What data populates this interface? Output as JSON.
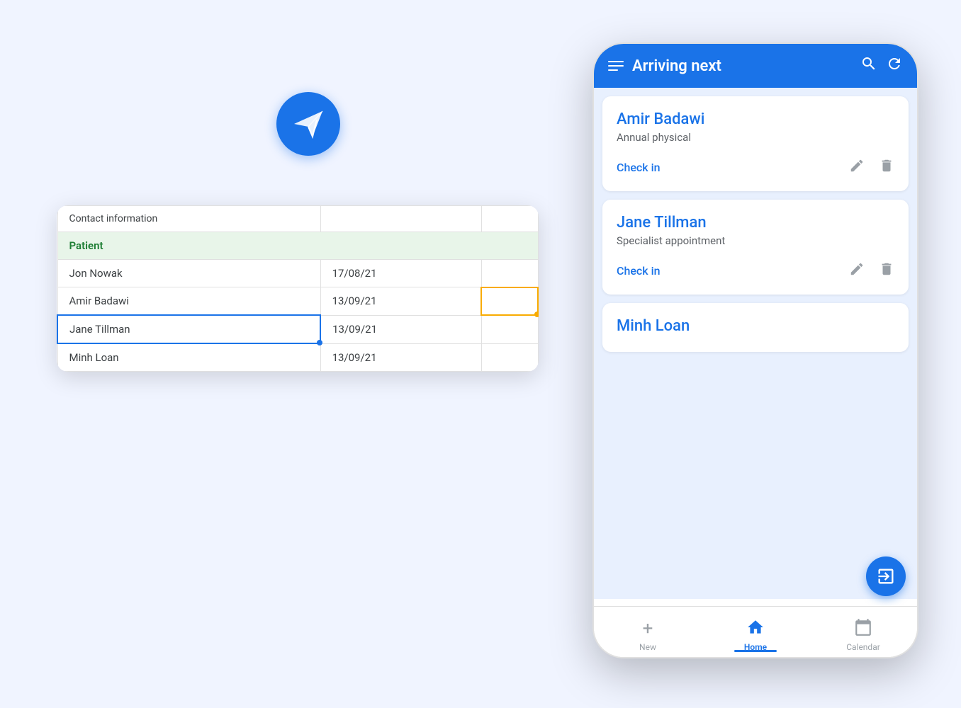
{
  "app": {
    "background": "#f0f4ff"
  },
  "spreadsheet": {
    "header": "Contact information",
    "section": "Patient",
    "rows": [
      {
        "name": "Jon Nowak",
        "date": "17/08/21",
        "extra": ""
      },
      {
        "name": "Amir Badawi",
        "date": "13/09/21",
        "extra": ""
      },
      {
        "name": "Jane Tillman",
        "date": "13/09/21",
        "extra": ""
      },
      {
        "name": "Minh Loan",
        "date": "13/09/21",
        "extra": ""
      }
    ]
  },
  "phone": {
    "header": {
      "title": "Arriving next",
      "search_label": "search",
      "refresh_label": "refresh"
    },
    "patients": [
      {
        "name": "Amir Badawi",
        "type": "Annual physical",
        "action": "Check in"
      },
      {
        "name": "Jane Tillman",
        "type": "Specialist appointment",
        "action": "Check in"
      },
      {
        "name": "Minh Loan",
        "type": "",
        "action": ""
      }
    ],
    "nav": {
      "items": [
        {
          "label": "New",
          "icon": "+",
          "active": false
        },
        {
          "label": "Home",
          "icon": "🏠",
          "active": true
        },
        {
          "label": "Calendar",
          "icon": "📅",
          "active": false
        }
      ]
    }
  }
}
